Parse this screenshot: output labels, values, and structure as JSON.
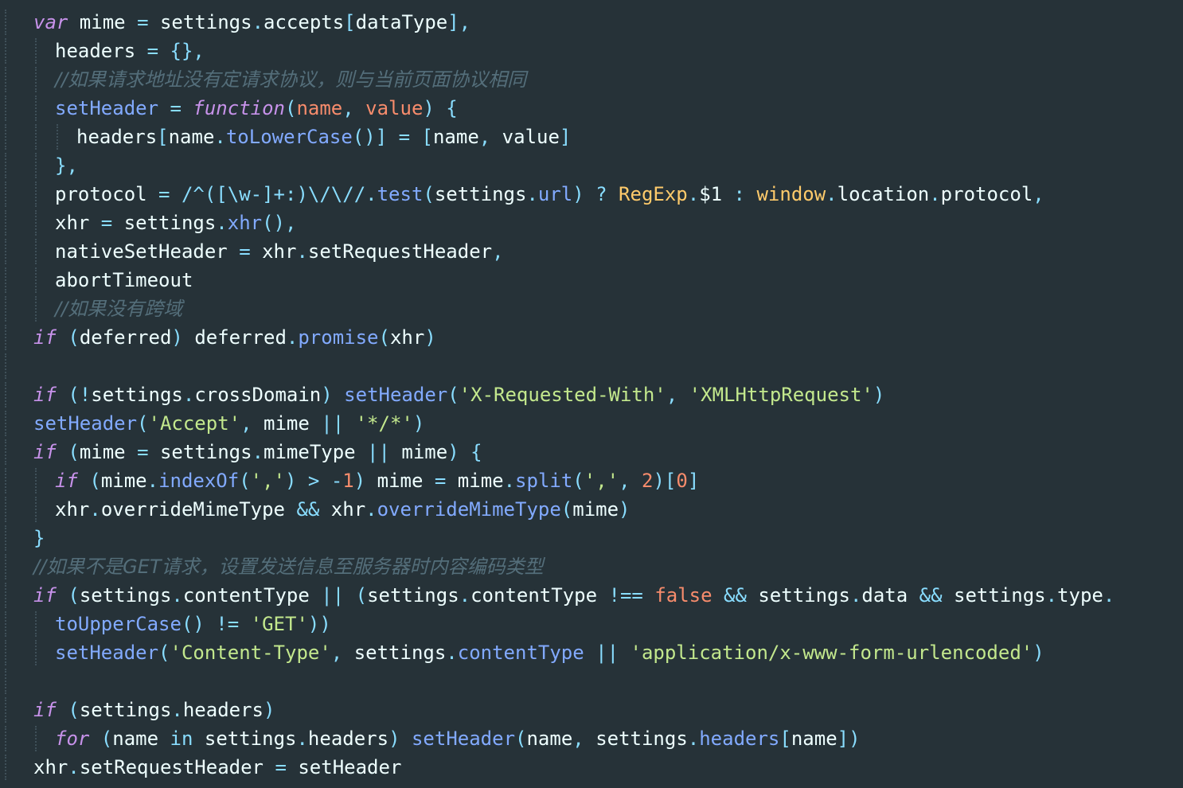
{
  "editor": {
    "colors": {
      "background": "#263238",
      "text": "#eeffff",
      "keyword": "#c792ea",
      "operator": "#89ddff",
      "function": "#82aaff",
      "string": "#c3e88d",
      "number": "#f78c6c",
      "class": "#ffcb6b",
      "comment": "#546e7a"
    },
    "lines": [
      {
        "indent": 0,
        "tokens": [
          {
            "t": "kw",
            "v": "var"
          },
          {
            "t": "var",
            "v": " mime "
          },
          {
            "t": "op",
            "v": "="
          },
          {
            "t": "var",
            "v": " settings"
          },
          {
            "t": "op",
            "v": "."
          },
          {
            "t": "prop",
            "v": "accepts"
          },
          {
            "t": "op",
            "v": "["
          },
          {
            "t": "var",
            "v": "dataType"
          },
          {
            "t": "op",
            "v": "],"
          }
        ]
      },
      {
        "indent": 1,
        "tokens": [
          {
            "t": "var",
            "v": "headers "
          },
          {
            "t": "op",
            "v": "= {},"
          }
        ]
      },
      {
        "indent": 1,
        "tokens": [
          {
            "t": "cmt",
            "v": "//如果请求地址没有定请求协议，则与当前页面协议相同"
          }
        ]
      },
      {
        "indent": 1,
        "tokens": [
          {
            "t": "fn",
            "v": "setHeader"
          },
          {
            "t": "op",
            "v": " = "
          },
          {
            "t": "kw",
            "v": "function"
          },
          {
            "t": "op",
            "v": "("
          },
          {
            "t": "param",
            "v": "name"
          },
          {
            "t": "op",
            "v": ", "
          },
          {
            "t": "param",
            "v": "value"
          },
          {
            "t": "op",
            "v": ") {"
          }
        ]
      },
      {
        "indent": 2,
        "tokens": [
          {
            "t": "var",
            "v": "headers"
          },
          {
            "t": "op",
            "v": "["
          },
          {
            "t": "var",
            "v": "name"
          },
          {
            "t": "op",
            "v": "."
          },
          {
            "t": "fn",
            "v": "toLowerCase"
          },
          {
            "t": "op",
            "v": "()] = ["
          },
          {
            "t": "var",
            "v": "name"
          },
          {
            "t": "op",
            "v": ", "
          },
          {
            "t": "var",
            "v": "value"
          },
          {
            "t": "op",
            "v": "]"
          }
        ]
      },
      {
        "indent": 1,
        "tokens": [
          {
            "t": "op",
            "v": "},"
          }
        ]
      },
      {
        "indent": 1,
        "tokens": [
          {
            "t": "var",
            "v": "protocol "
          },
          {
            "t": "op",
            "v": "= "
          },
          {
            "t": "regex",
            "v": "/^([\\w-]+:)\\/\\//"
          },
          {
            "t": "op",
            "v": "."
          },
          {
            "t": "fn",
            "v": "test"
          },
          {
            "t": "op",
            "v": "("
          },
          {
            "t": "var",
            "v": "settings"
          },
          {
            "t": "op",
            "v": "."
          },
          {
            "t": "fn",
            "v": "url"
          },
          {
            "t": "op",
            "v": ") ? "
          },
          {
            "t": "class",
            "v": "RegExp"
          },
          {
            "t": "op",
            "v": "."
          },
          {
            "t": "var",
            "v": "$1"
          },
          {
            "t": "op",
            "v": " : "
          },
          {
            "t": "class",
            "v": "window"
          },
          {
            "t": "op",
            "v": "."
          },
          {
            "t": "prop",
            "v": "location"
          },
          {
            "t": "op",
            "v": "."
          },
          {
            "t": "prop",
            "v": "protocol"
          },
          {
            "t": "op",
            "v": ","
          }
        ]
      },
      {
        "indent": 1,
        "tokens": [
          {
            "t": "var",
            "v": "xhr "
          },
          {
            "t": "op",
            "v": "= "
          },
          {
            "t": "var",
            "v": "settings"
          },
          {
            "t": "op",
            "v": "."
          },
          {
            "t": "fn",
            "v": "xhr"
          },
          {
            "t": "op",
            "v": "(),"
          }
        ]
      },
      {
        "indent": 1,
        "tokens": [
          {
            "t": "var",
            "v": "nativeSetHeader "
          },
          {
            "t": "op",
            "v": "= "
          },
          {
            "t": "var",
            "v": "xhr"
          },
          {
            "t": "op",
            "v": "."
          },
          {
            "t": "prop",
            "v": "setRequestHeader"
          },
          {
            "t": "op",
            "v": ","
          }
        ]
      },
      {
        "indent": 1,
        "tokens": [
          {
            "t": "var",
            "v": "abortTimeout"
          }
        ]
      },
      {
        "indent": 1,
        "tokens": [
          {
            "t": "cmt",
            "v": "//如果没有跨域"
          }
        ]
      },
      {
        "indent": 0,
        "tokens": [
          {
            "t": "kw",
            "v": "if"
          },
          {
            "t": "op",
            "v": " ("
          },
          {
            "t": "var",
            "v": "deferred"
          },
          {
            "t": "op",
            "v": ") "
          },
          {
            "t": "var",
            "v": "deferred"
          },
          {
            "t": "op",
            "v": "."
          },
          {
            "t": "fn",
            "v": "promise"
          },
          {
            "t": "op",
            "v": "("
          },
          {
            "t": "var",
            "v": "xhr"
          },
          {
            "t": "op",
            "v": ")"
          }
        ]
      },
      {
        "indent": 0,
        "tokens": []
      },
      {
        "indent": 0,
        "tokens": [
          {
            "t": "kw",
            "v": "if"
          },
          {
            "t": "op",
            "v": " (!"
          },
          {
            "t": "var",
            "v": "settings"
          },
          {
            "t": "op",
            "v": "."
          },
          {
            "t": "prop",
            "v": "crossDomain"
          },
          {
            "t": "op",
            "v": ") "
          },
          {
            "t": "fn",
            "v": "setHeader"
          },
          {
            "t": "op",
            "v": "("
          },
          {
            "t": "str",
            "v": "'X-Requested-With'"
          },
          {
            "t": "op",
            "v": ", "
          },
          {
            "t": "str",
            "v": "'XMLHttpRequest'"
          },
          {
            "t": "op",
            "v": ")"
          }
        ]
      },
      {
        "indent": 0,
        "tokens": [
          {
            "t": "fn",
            "v": "setHeader"
          },
          {
            "t": "op",
            "v": "("
          },
          {
            "t": "str",
            "v": "'Accept'"
          },
          {
            "t": "op",
            "v": ", "
          },
          {
            "t": "var",
            "v": "mime"
          },
          {
            "t": "op",
            "v": " || "
          },
          {
            "t": "str",
            "v": "'*/*'"
          },
          {
            "t": "op",
            "v": ")"
          }
        ]
      },
      {
        "indent": 0,
        "tokens": [
          {
            "t": "kw",
            "v": "if"
          },
          {
            "t": "op",
            "v": " ("
          },
          {
            "t": "var",
            "v": "mime "
          },
          {
            "t": "op",
            "v": "= "
          },
          {
            "t": "var",
            "v": "settings"
          },
          {
            "t": "op",
            "v": "."
          },
          {
            "t": "prop",
            "v": "mimeType"
          },
          {
            "t": "op",
            "v": " || "
          },
          {
            "t": "var",
            "v": "mime"
          },
          {
            "t": "op",
            "v": ") {"
          }
        ]
      },
      {
        "indent": 1,
        "tokens": [
          {
            "t": "kw",
            "v": "if"
          },
          {
            "t": "op",
            "v": " ("
          },
          {
            "t": "var",
            "v": "mime"
          },
          {
            "t": "op",
            "v": "."
          },
          {
            "t": "fn",
            "v": "indexOf"
          },
          {
            "t": "op",
            "v": "("
          },
          {
            "t": "str",
            "v": "','"
          },
          {
            "t": "op",
            "v": ") > -"
          },
          {
            "t": "num",
            "v": "1"
          },
          {
            "t": "op",
            "v": ") "
          },
          {
            "t": "var",
            "v": "mime "
          },
          {
            "t": "op",
            "v": "= "
          },
          {
            "t": "var",
            "v": "mime"
          },
          {
            "t": "op",
            "v": "."
          },
          {
            "t": "fn",
            "v": "split"
          },
          {
            "t": "op",
            "v": "("
          },
          {
            "t": "str",
            "v": "','"
          },
          {
            "t": "op",
            "v": ", "
          },
          {
            "t": "num",
            "v": "2"
          },
          {
            "t": "op",
            "v": ")["
          },
          {
            "t": "num",
            "v": "0"
          },
          {
            "t": "op",
            "v": "]"
          }
        ]
      },
      {
        "indent": 1,
        "tokens": [
          {
            "t": "var",
            "v": "xhr"
          },
          {
            "t": "op",
            "v": "."
          },
          {
            "t": "prop",
            "v": "overrideMimeType"
          },
          {
            "t": "op",
            "v": " && "
          },
          {
            "t": "var",
            "v": "xhr"
          },
          {
            "t": "op",
            "v": "."
          },
          {
            "t": "fn",
            "v": "overrideMimeType"
          },
          {
            "t": "op",
            "v": "("
          },
          {
            "t": "var",
            "v": "mime"
          },
          {
            "t": "op",
            "v": ")"
          }
        ]
      },
      {
        "indent": 0,
        "tokens": [
          {
            "t": "op",
            "v": "}"
          }
        ]
      },
      {
        "indent": 0,
        "tokens": [
          {
            "t": "cmt",
            "v": "//如果不是GET请求，设置发送信息至服务器时内容编码类型"
          }
        ]
      },
      {
        "indent": 0,
        "tokens": [
          {
            "t": "kw",
            "v": "if"
          },
          {
            "t": "op",
            "v": " ("
          },
          {
            "t": "var",
            "v": "settings"
          },
          {
            "t": "op",
            "v": "."
          },
          {
            "t": "prop",
            "v": "contentType"
          },
          {
            "t": "op",
            "v": " || ("
          },
          {
            "t": "var",
            "v": "settings"
          },
          {
            "t": "op",
            "v": "."
          },
          {
            "t": "prop",
            "v": "contentType"
          },
          {
            "t": "op",
            "v": " !== "
          },
          {
            "t": "bool",
            "v": "false"
          },
          {
            "t": "op",
            "v": " && "
          },
          {
            "t": "var",
            "v": "settings"
          },
          {
            "t": "op",
            "v": "."
          },
          {
            "t": "prop",
            "v": "data"
          },
          {
            "t": "op",
            "v": " && "
          },
          {
            "t": "var",
            "v": "settings"
          },
          {
            "t": "op",
            "v": "."
          },
          {
            "t": "prop",
            "v": "type"
          },
          {
            "t": "op",
            "v": "."
          }
        ]
      },
      {
        "indent": 1,
        "tokens": [
          {
            "t": "fn",
            "v": "toUpperCase"
          },
          {
            "t": "op",
            "v": "() != "
          },
          {
            "t": "str",
            "v": "'GET'"
          },
          {
            "t": "op",
            "v": "))"
          }
        ]
      },
      {
        "indent": 1,
        "tokens": [
          {
            "t": "fn",
            "v": "setHeader"
          },
          {
            "t": "op",
            "v": "("
          },
          {
            "t": "str",
            "v": "'Content-Type'"
          },
          {
            "t": "op",
            "v": ", "
          },
          {
            "t": "var",
            "v": "settings"
          },
          {
            "t": "op",
            "v": "."
          },
          {
            "t": "fn",
            "v": "contentType"
          },
          {
            "t": "op",
            "v": " || "
          },
          {
            "t": "str",
            "v": "'application/x-www-form-urlencoded'"
          },
          {
            "t": "op",
            "v": ")"
          }
        ]
      },
      {
        "indent": 0,
        "tokens": []
      },
      {
        "indent": 0,
        "tokens": [
          {
            "t": "kw",
            "v": "if"
          },
          {
            "t": "op",
            "v": " ("
          },
          {
            "t": "var",
            "v": "settings"
          },
          {
            "t": "op",
            "v": "."
          },
          {
            "t": "prop",
            "v": "headers"
          },
          {
            "t": "op",
            "v": ")"
          }
        ]
      },
      {
        "indent": 1,
        "tokens": [
          {
            "t": "kw",
            "v": "for"
          },
          {
            "t": "op",
            "v": " ("
          },
          {
            "t": "var",
            "v": "name "
          },
          {
            "t": "op",
            "v": "in "
          },
          {
            "t": "var",
            "v": "settings"
          },
          {
            "t": "op",
            "v": "."
          },
          {
            "t": "prop",
            "v": "headers"
          },
          {
            "t": "op",
            "v": ") "
          },
          {
            "t": "fn",
            "v": "setHeader"
          },
          {
            "t": "op",
            "v": "("
          },
          {
            "t": "var",
            "v": "name"
          },
          {
            "t": "op",
            "v": ", "
          },
          {
            "t": "var",
            "v": "settings"
          },
          {
            "t": "op",
            "v": "."
          },
          {
            "t": "fn",
            "v": "headers"
          },
          {
            "t": "op",
            "v": "["
          },
          {
            "t": "var",
            "v": "name"
          },
          {
            "t": "op",
            "v": "])"
          }
        ]
      },
      {
        "indent": 0,
        "tokens": [
          {
            "t": "var",
            "v": "xhr"
          },
          {
            "t": "op",
            "v": "."
          },
          {
            "t": "prop",
            "v": "setRequestHeader"
          },
          {
            "t": "op",
            "v": " = "
          },
          {
            "t": "var",
            "v": "setHeader"
          }
        ]
      }
    ]
  }
}
